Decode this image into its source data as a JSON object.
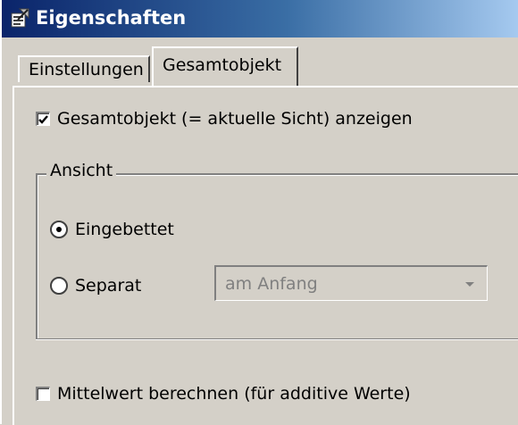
{
  "window": {
    "title": "Eigenschaften",
    "title_icon": "properties-icon"
  },
  "tabs": [
    {
      "label": "Einstellungen",
      "active": false
    },
    {
      "label": "Gesamtobjekt",
      "active": true
    }
  ],
  "panel": {
    "show_overall_label": "Gesamtobjekt (= aktuelle Sicht) anzeigen",
    "show_overall_checked": true,
    "view_group": {
      "legend": "Ansicht",
      "embedded_label": "Eingebettet",
      "embedded_selected": true,
      "separate_label": "Separat",
      "separate_selected": false,
      "position_select": {
        "value": "am Anfang",
        "enabled": false
      }
    },
    "average_label": "Mittelwert berechnen (für additive Werte)",
    "average_checked": false
  },
  "colors": {
    "title_gradient_start": "#0a246a",
    "title_gradient_end": "#a6caf0",
    "face": "#d4d0c8",
    "disabled_text": "#808080"
  }
}
